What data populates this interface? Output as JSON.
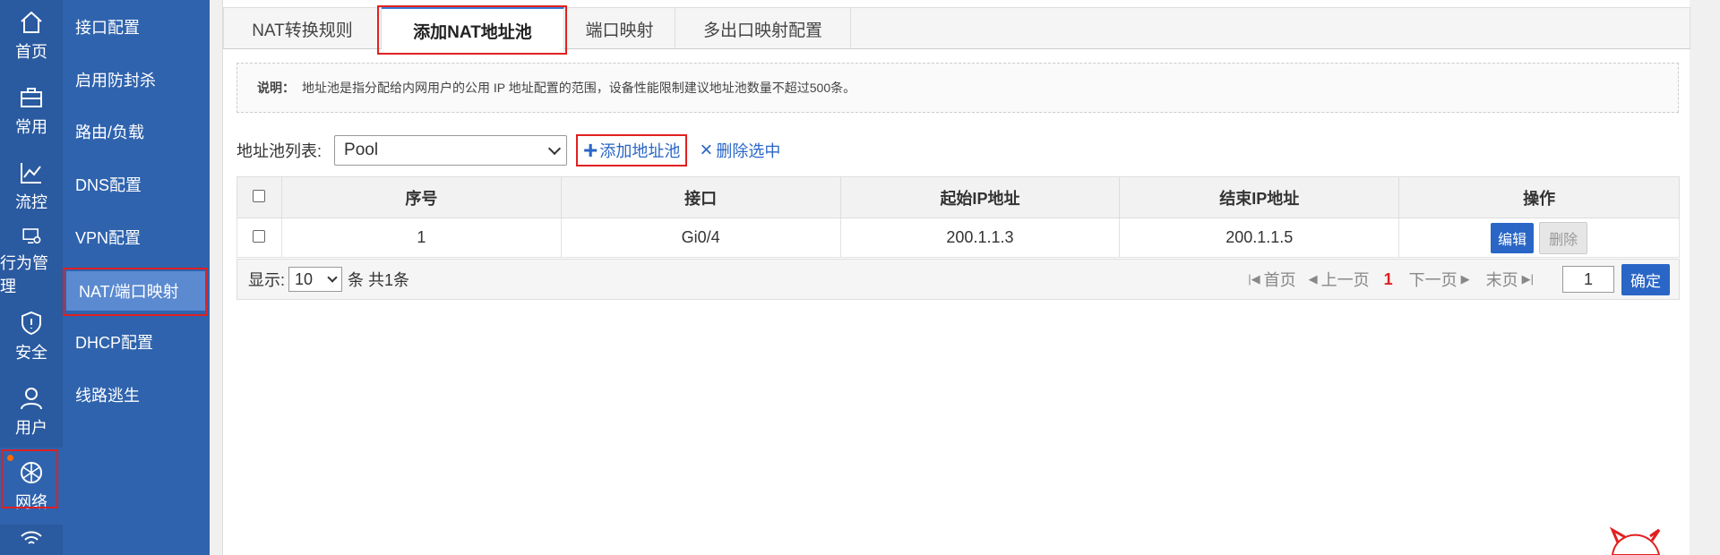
{
  "rail": {
    "items": [
      {
        "label": "首页",
        "icon": "home-icon"
      },
      {
        "label": "常用",
        "icon": "toolbox-icon"
      },
      {
        "label": "流控",
        "icon": "chart-line-icon"
      },
      {
        "label": "行为管理",
        "icon": "monitor-settings-icon"
      },
      {
        "label": "安全",
        "icon": "shield-icon"
      },
      {
        "label": "用户",
        "icon": "user-icon"
      },
      {
        "label": "网络",
        "icon": "network-globe-icon"
      },
      {
        "label": "",
        "icon": "wifi-icon"
      }
    ]
  },
  "submenu": {
    "items": [
      {
        "label": "接口配置"
      },
      {
        "label": "启用防封杀"
      },
      {
        "label": "路由/负载"
      },
      {
        "label": "DNS配置"
      },
      {
        "label": "VPN配置"
      },
      {
        "label": "NAT/端口映射"
      },
      {
        "label": "DHCP配置"
      },
      {
        "label": "线路逃生"
      }
    ]
  },
  "tabs": [
    {
      "label": "NAT转换规则"
    },
    {
      "label": "添加NAT地址池"
    },
    {
      "label": "端口映射"
    },
    {
      "label": "多出口映射配置"
    }
  ],
  "note": {
    "label": "说明：",
    "text": "地址池是指分配给内网用户的公用 IP 地址配置的范围，设备性能限制建议地址池数量不超过500条。"
  },
  "toolbar": {
    "pool_list_label": "地址池列表:",
    "pool_selected": "Pool",
    "add_label": "添加地址池",
    "delete_label": "删除选中"
  },
  "table": {
    "headers": [
      "序号",
      "接口",
      "起始IP地址",
      "结束IP地址",
      "操作"
    ],
    "rows": [
      {
        "index": "1",
        "interface": "Gi0/4",
        "start_ip": "200.1.1.3",
        "end_ip": "200.1.1.5",
        "edit": "编辑",
        "delete": "删除"
      }
    ]
  },
  "pager": {
    "show_label": "显示:",
    "page_size": "10",
    "summary": "条 共1条",
    "first": "首页",
    "prev": "上一页",
    "current": "1",
    "next": "下一页",
    "last": "末页",
    "goto_value": "1",
    "confirm": "确定"
  },
  "colors": {
    "rail_bg": "#2a5aa0",
    "submenu_bg": "#2f63ad",
    "accent": "#2a66c6",
    "highlight_box": "#e02020"
  }
}
